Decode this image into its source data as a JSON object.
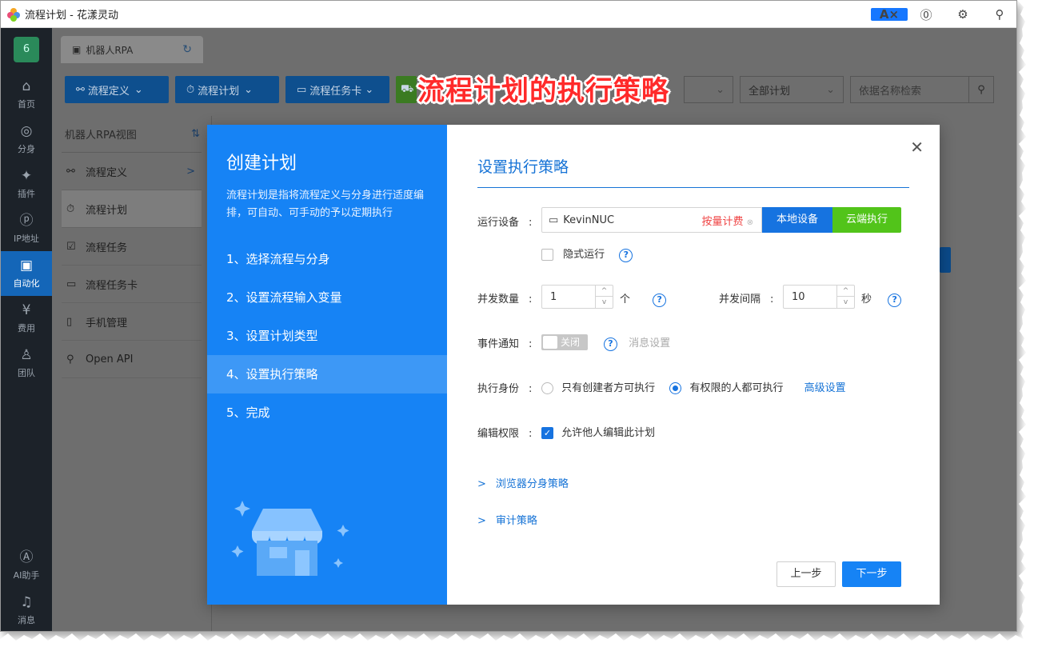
{
  "window": {
    "title": "流程计划 - 花漾灵动"
  },
  "rail": {
    "badge": "6",
    "items": [
      {
        "label": "首页",
        "icon": "home-icon",
        "glyph": "⌂"
      },
      {
        "label": "分身",
        "icon": "browser-icon",
        "glyph": "◎"
      },
      {
        "label": "插件",
        "icon": "plugin-icon",
        "glyph": "✦"
      },
      {
        "label": "IP地址",
        "icon": "ip-icon",
        "glyph": "ⓟ"
      },
      {
        "label": "自动化",
        "icon": "robot-icon",
        "glyph": "▣",
        "active": true
      },
      {
        "label": "费用",
        "icon": "yen-icon",
        "glyph": "¥"
      },
      {
        "label": "团队",
        "icon": "team-icon",
        "glyph": "♙"
      }
    ],
    "bottom": [
      {
        "label": "AI助手",
        "icon": "ai-icon",
        "glyph": "Ⓐ"
      },
      {
        "label": "消息",
        "icon": "bell-icon",
        "glyph": "♫"
      }
    ]
  },
  "tab": {
    "label": "机器人RPA"
  },
  "toolbar": {
    "btn1": "流程定义",
    "btn2": "流程计划",
    "btn3": "流程任务卡",
    "filter_all": "全部计划",
    "search_placeholder": "依据名称检索"
  },
  "sidemenu": {
    "header": "机器人RPA视图",
    "items": [
      {
        "label": "流程定义",
        "icon": "flow-icon",
        "glyph": "⚯"
      },
      {
        "label": "流程计划",
        "icon": "timer-icon",
        "glyph": "⏱",
        "active": true
      },
      {
        "label": "流程任务",
        "icon": "clipboard-icon",
        "glyph": "☑"
      },
      {
        "label": "流程任务卡",
        "icon": "card-icon",
        "glyph": "▭"
      },
      {
        "label": "手机管理",
        "icon": "phone-icon",
        "glyph": "▯"
      },
      {
        "label": "Open API",
        "icon": "api-icon",
        "glyph": "⚲"
      }
    ]
  },
  "annotation": "流程计划的执行策略",
  "modal": {
    "left_title": "创建计划",
    "left_desc": "流程计划是指将流程定义与分身进行适度编排，可自动、可手动的予以定期执行",
    "steps": [
      "1、选择流程与分身",
      "2、设置流程输入变量",
      "3、设置计划类型",
      "4、设置执行策略",
      "5、完成"
    ],
    "active_step": 3,
    "title": "设置执行策略",
    "device_label": "运行设备",
    "device_value": "KevinNUC",
    "billing": "按量计费",
    "btn_local": "本地设备",
    "btn_cloud": "云端执行",
    "hidden_run": "隐式运行",
    "concurrency_label": "并发数量",
    "concurrency_value": "1",
    "concurrency_unit": "个",
    "interval_label": "并发间隔",
    "interval_value": "10",
    "interval_unit": "秒",
    "notify_label": "事件通知",
    "notify_toggle": "关闭",
    "notify_settings": "消息设置",
    "identity_label": "执行身份",
    "identity_opt1": "只有创建者方可执行",
    "identity_opt2": "有权限的人都可执行",
    "advanced": "高级设置",
    "edit_label": "编辑权限",
    "edit_allow": "允许他人编辑此计划",
    "exp_browser": "浏览器分身策略",
    "exp_audit": "审计策略",
    "btn_prev": "上一步",
    "btn_next": "下一步"
  },
  "colors": {
    "primary": "#1683f5",
    "cloud": "#52c41a",
    "billing": "#ef4444",
    "annotation": "#ff2a2a"
  }
}
